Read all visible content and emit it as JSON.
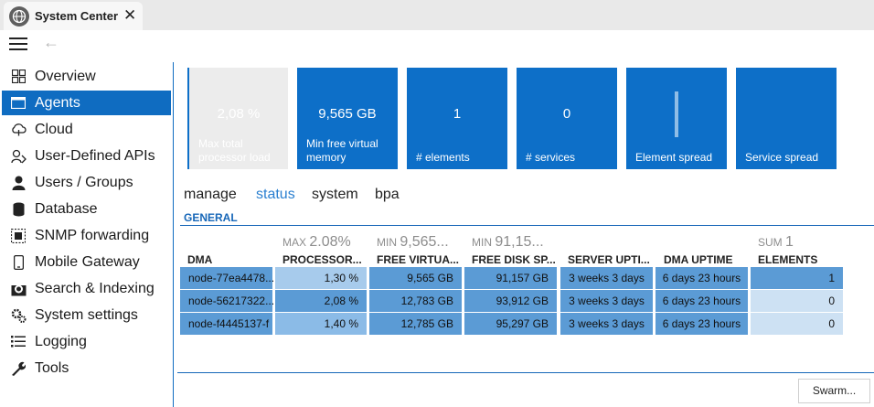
{
  "window": {
    "title": "System Center",
    "close": "✕"
  },
  "toolbar": {
    "back": "←"
  },
  "sidebar": {
    "items": [
      {
        "label": "Overview",
        "icon": "overview-icon",
        "active": false
      },
      {
        "label": "Agents",
        "icon": "agents-icon",
        "active": true
      },
      {
        "label": "Cloud",
        "icon": "cloud-icon",
        "active": false
      },
      {
        "label": "User-Defined APIs",
        "icon": "api-icon",
        "active": false
      },
      {
        "label": "Users / Groups",
        "icon": "user-icon",
        "active": false
      },
      {
        "label": "Database",
        "icon": "database-icon",
        "active": false
      },
      {
        "label": "SNMP forwarding",
        "icon": "snmp-icon",
        "active": false
      },
      {
        "label": "Mobile Gateway",
        "icon": "mobile-icon",
        "active": false
      },
      {
        "label": "Search & Indexing",
        "icon": "search-icon",
        "active": false
      },
      {
        "label": "System settings",
        "icon": "gear-icon",
        "active": false
      },
      {
        "label": "Logging",
        "icon": "list-icon",
        "active": false
      },
      {
        "label": "Tools",
        "icon": "wrench-icon",
        "active": false
      }
    ]
  },
  "tiles": [
    {
      "value": "2,08 %",
      "caption": "Max total processor load",
      "disabled": true
    },
    {
      "value": "9,565 GB",
      "caption": "Min free virtual memory"
    },
    {
      "value": "1",
      "caption": "# elements"
    },
    {
      "value": "0",
      "caption": "# services"
    },
    {
      "value": "",
      "caption": "Element spread"
    },
    {
      "value": "",
      "caption": "Service spread"
    }
  ],
  "subtabs": [
    "manage",
    "status",
    "system",
    "bpa"
  ],
  "active_subtab": "status",
  "section": "GENERAL",
  "table": {
    "summaries": [
      {
        "prefix": "MAX",
        "value": "2.08%"
      },
      {
        "prefix": "MIN",
        "value": "9,565..."
      },
      {
        "prefix": "MIN",
        "value": "91,15..."
      },
      {
        "prefix": "SUM",
        "value": "1"
      }
    ],
    "headers": [
      "DMA",
      "PROCESSOR...",
      "FREE VIRTUA...",
      "FREE DISK SP...",
      "SERVER UPTI...",
      "DMA UPTIME",
      "ELEMENTS"
    ],
    "rows": [
      [
        "node-77ea4478...",
        "1,30 %",
        "9,565 GB",
        "91,157 GB",
        "3 weeks 3 days",
        "6 days 23 hours",
        "1"
      ],
      [
        "node-56217322...",
        "2,08 %",
        "12,783 GB",
        "93,912 GB",
        "3 weeks 3 days",
        "6 days 23 hours",
        "0"
      ],
      [
        "node-f4445137-f",
        "1,40 %",
        "12,785 GB",
        "95,297 GB",
        "3 weeks 3 days",
        "6 days 23 hours",
        "0"
      ]
    ]
  },
  "swarm_button": "Swarm...",
  "colors": {
    "accent": "#0f6cc1",
    "tile": "#0d6fc8",
    "cell_dark": "#5b9bd5",
    "cell_mid": "#7fb2e2",
    "cell_light": "#cde1f3"
  }
}
